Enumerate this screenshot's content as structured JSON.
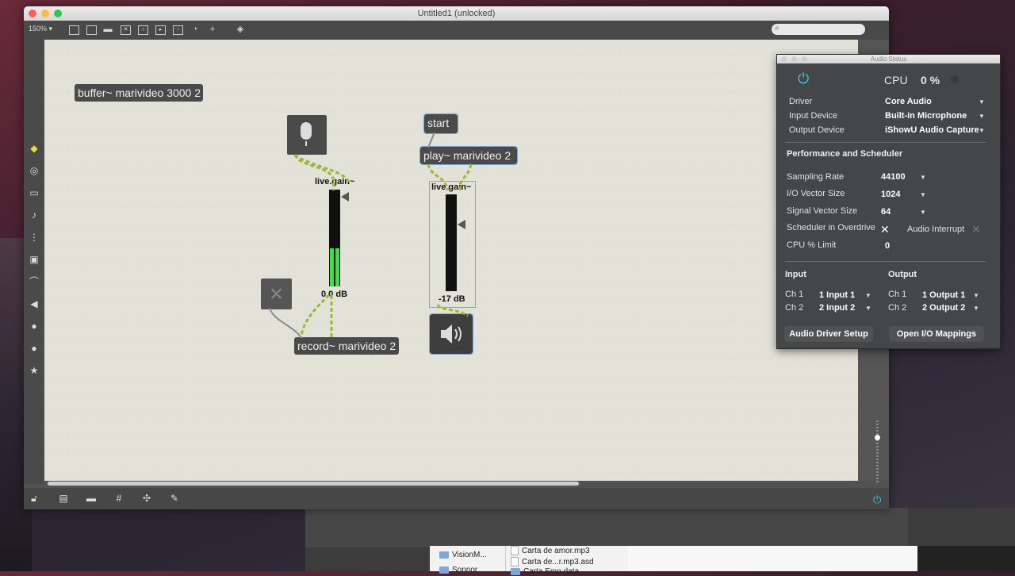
{
  "window": {
    "title": "Untitled1 (unlocked)",
    "zoom": "150%",
    "zoom_arrow": "▾"
  },
  "toolbar_icons": [
    "presentation-icon",
    "text-icon",
    "comment-icon",
    "toggle-icon",
    "button-icon",
    "message-icon",
    "bpatcher-icon",
    "dial-icon",
    "add-icon",
    "paint-icon"
  ],
  "left_icons": [
    "cube-icon",
    "target-icon",
    "device-icon",
    "note-icon",
    "step-icon",
    "image-icon",
    "clip-icon",
    "plug-icon",
    "v-icon",
    "g-icon",
    "star-icon"
  ],
  "patch": {
    "buffer": "buffer~ marivideo 3000 2",
    "start": "start",
    "play": "play~ marivideo 2",
    "gain1_label": "live.gain~",
    "gain1_db": "0.0 dB",
    "gain2_label": "live.gain~",
    "gain2_db": "-17 dB",
    "record": "record~ marivideo 2",
    "x_toggle": "×"
  },
  "audio_status": {
    "title": "Audio Status",
    "cpu_label": "CPU",
    "cpu_value": "0 %",
    "driver_label": "Driver",
    "driver_value": "Core Audio",
    "input_label": "Input Device",
    "input_value": "Built-in Microphone",
    "output_label": "Output Device",
    "output_value": "iShowU Audio Capture",
    "perf_section": "Performance and Scheduler",
    "sr_label": "Sampling Rate",
    "sr_value": "44100",
    "io_label": "I/O Vector Size",
    "io_value": "1024",
    "sv_label": "Signal Vector Size",
    "sv_value": "64",
    "overdrive_label": "Scheduler in Overdrive",
    "interrupt_label": "Audio Interrupt",
    "cpulimit_label": "CPU % Limit",
    "cpulimit_value": "0",
    "input_section": "Input",
    "output_section": "Output",
    "in_ch1_label": "Ch 1",
    "in_ch1_value": "1 Input 1",
    "in_ch2_label": "Ch 2",
    "in_ch2_value": "2 Input 2",
    "out_ch1_label": "Ch 1",
    "out_ch1_value": "1 Output 1",
    "out_ch2_label": "Ch 2",
    "out_ch2_value": "2 Output 2",
    "driver_setup_btn": "Audio Driver Setup",
    "io_mappings_btn": "Open I/O Mappings"
  },
  "finder": {
    "folder1": "VisionM...",
    "folder2": "Sonnor",
    "file1": "Carta de amor.mp3",
    "file2": "Carta de...r.mp3.asd",
    "file3": "Carta Emo data"
  }
}
